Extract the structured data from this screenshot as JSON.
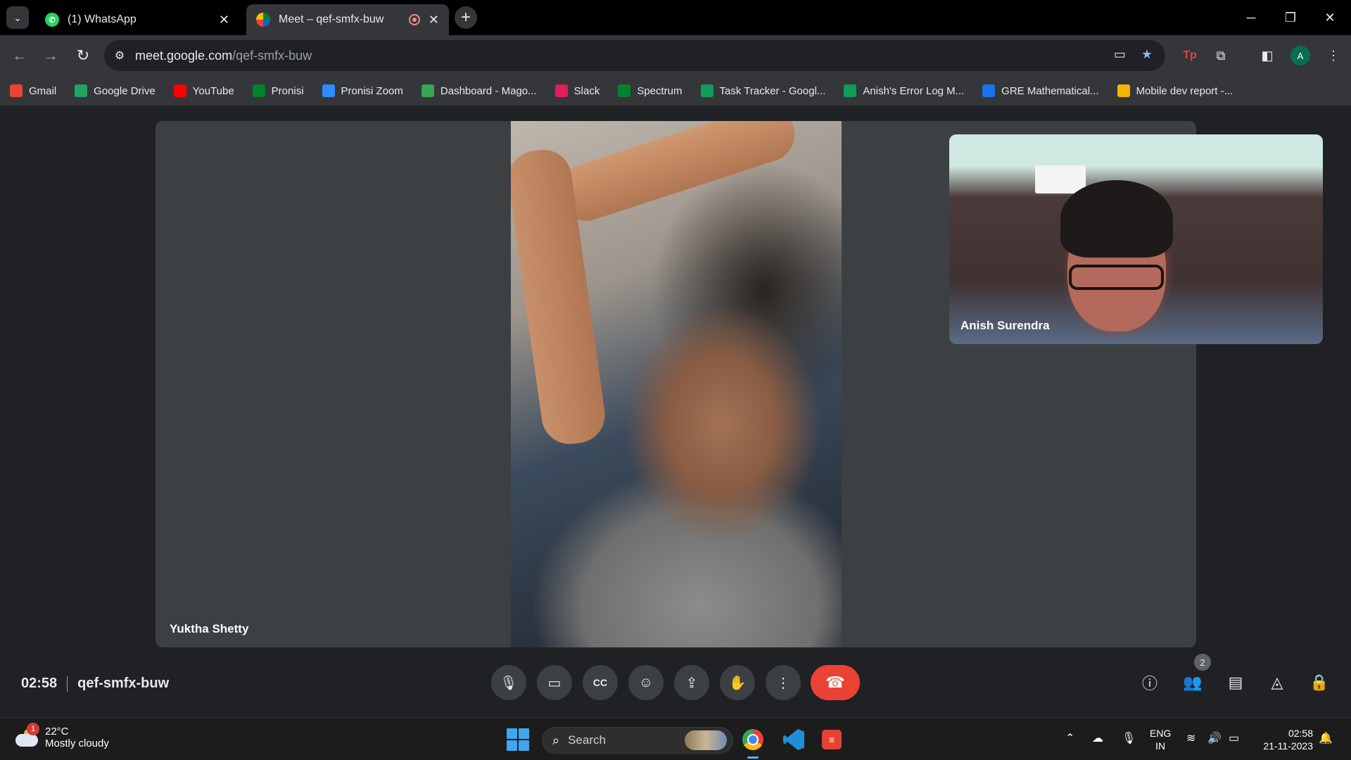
{
  "browser": {
    "tabs": [
      {
        "title": "(1) WhatsApp",
        "active": false,
        "favicon": "whatsapp-icon"
      },
      {
        "title": "Meet – qef-smfx-buw",
        "active": true,
        "favicon": "google-meet-icon",
        "recording": true
      }
    ],
    "url_host": "meet.google.com",
    "url_path": "/qef-smfx-buw",
    "profile_initial": "A"
  },
  "bookmarks": [
    {
      "label": "Gmail",
      "icon": "gmail-icon",
      "color": "#ea4335"
    },
    {
      "label": "Google Drive",
      "icon": "drive-icon",
      "color": "#1fa463"
    },
    {
      "label": "YouTube",
      "icon": "youtube-icon",
      "color": "#ff0000"
    },
    {
      "label": "Pronisi",
      "icon": "meet-icon",
      "color": "#00832d"
    },
    {
      "label": "Pronisi Zoom",
      "icon": "zoom-icon",
      "color": "#2d8cff"
    },
    {
      "label": "Dashboard - Mago...",
      "icon": "dashboard-icon",
      "color": "#34a853"
    },
    {
      "label": "Slack",
      "icon": "slack-icon",
      "color": "#e01e5a"
    },
    {
      "label": "Spectrum",
      "icon": "meet-icon",
      "color": "#00832d"
    },
    {
      "label": "Task Tracker - Googl...",
      "icon": "sheets-icon",
      "color": "#0f9d58"
    },
    {
      "label": "Anish's Error Log M...",
      "icon": "sheets-icon",
      "color": "#0f9d58"
    },
    {
      "label": "GRE Mathematical...",
      "icon": "loader-icon",
      "color": "#1a73e8"
    },
    {
      "label": "Mobile dev report -...",
      "icon": "slides-icon",
      "color": "#f4b400"
    }
  ],
  "meet": {
    "main_participant": "Yuktha Shetty",
    "pip_participant": "Anish Surendra",
    "time": "02:58",
    "meeting_code": "qef-smfx-buw",
    "participant_count": "2"
  },
  "taskbar": {
    "weather_badge": "1",
    "temperature": "22°C",
    "condition": "Mostly cloudy",
    "search_placeholder": "Search",
    "lang_line1": "ENG",
    "lang_line2": "IN",
    "time": "02:58",
    "date": "21-11-2023"
  }
}
